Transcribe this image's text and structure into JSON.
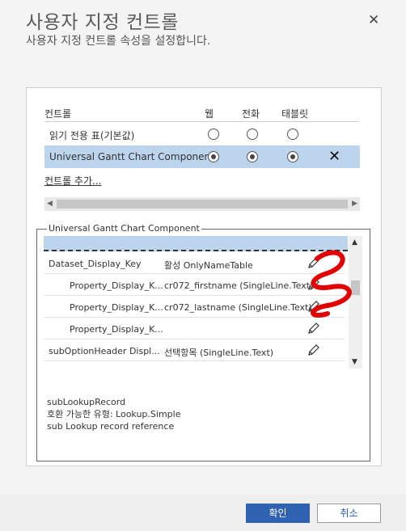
{
  "dialog": {
    "title": "사용자 지정 컨트롤",
    "subtitle": "사용자 지정 컨트롤 속성을 설정합니다.",
    "close_icon": "close-icon"
  },
  "controls_table": {
    "headers": [
      "컨트롤",
      "웹",
      "전화",
      "태블릿"
    ],
    "rows": [
      {
        "name": "읽기 전용 표(기본값)",
        "web": false,
        "phone": false,
        "tablet": false,
        "selected_row": false
      },
      {
        "name": "Universal Gantt Chart Component",
        "web": true,
        "phone": true,
        "tablet": true,
        "selected_row": true
      }
    ],
    "add_link": "컨트롤 추가..."
  },
  "properties": {
    "legend": "Universal Gantt Chart Component",
    "rows": [
      {
        "key": "Dataset_Display_Key",
        "value": "활성 OnlyNameTable",
        "indent": false
      },
      {
        "key": "Property_Display_K...",
        "value": "cr072_firstname (SingleLine.Text)",
        "indent": true
      },
      {
        "key": "Property_Display_K...",
        "value": "cr072_lastname (SingleLine.Text)",
        "indent": true
      },
      {
        "key": "Property_Display_K...",
        "value": "",
        "indent": true
      },
      {
        "key": "subOptionHeader Displ...",
        "value": "선택항목 (SingleLine.Text)",
        "indent": false
      }
    ],
    "info_lines": [
      "subLookupRecord",
      "호환 가능한 유형: Lookup.Simple",
      "sub Lookup record reference"
    ]
  },
  "footer": {
    "ok_label": "확인",
    "cancel_label": "취소"
  },
  "colors": {
    "accent": "#2f62b0",
    "selected_row": "#bcd4ec",
    "scribble": "#e00000"
  }
}
